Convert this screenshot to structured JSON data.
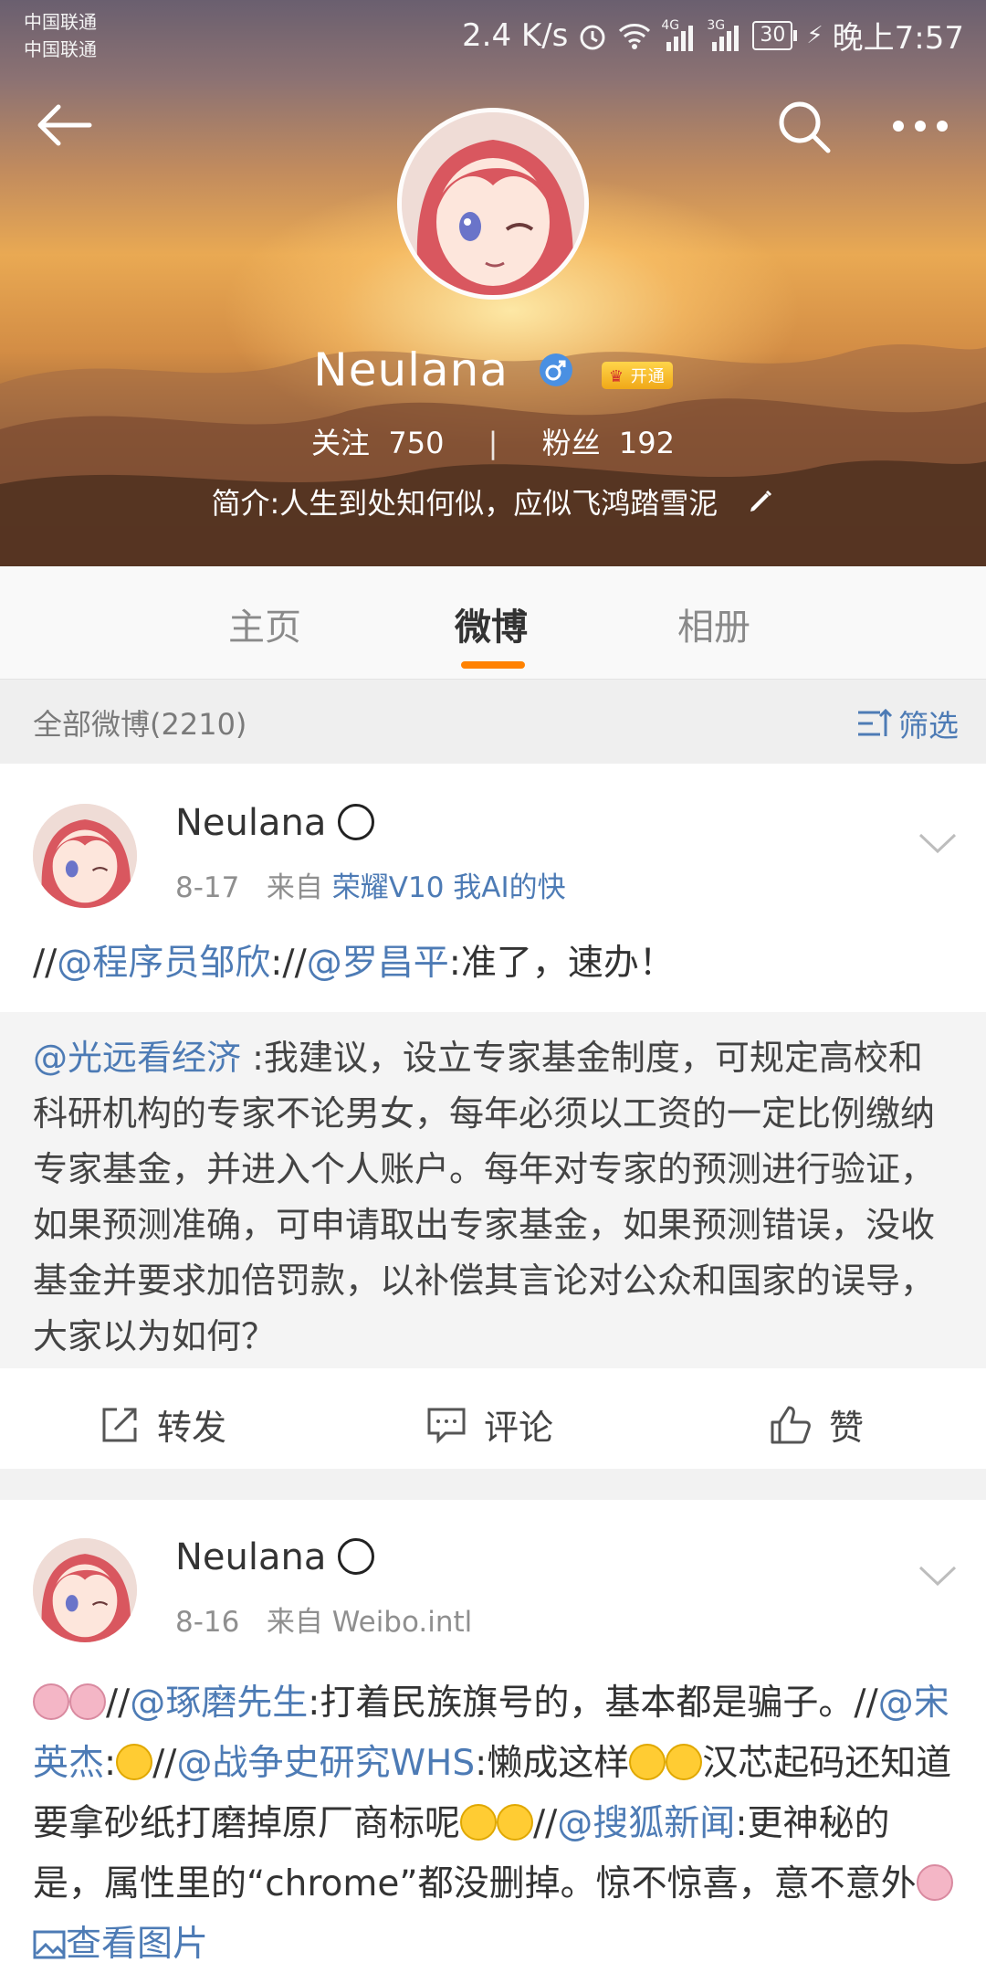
{
  "status_bar": {
    "carrier1": "中国联通",
    "carrier2": "中国联通",
    "speed": "2.4 K/s",
    "net1": "4G",
    "net2": "3G",
    "battery": "30",
    "time": "晚上7:57"
  },
  "profile": {
    "name": "Neulana",
    "vip_badge": "开通",
    "following_label": "关注",
    "following": "750",
    "separator": "|",
    "followers_label": "粉丝",
    "followers": "192",
    "bio": "简介:人生到处知何似，应似飞鸿踏雪泥"
  },
  "icons": {
    "back": "back-arrow-icon",
    "search": "search-icon",
    "more": "more-icon",
    "gender": "male-icon",
    "vip": "crown-icon",
    "edit": "pencil-icon",
    "filter": "filter-icon",
    "repost": "repost-icon",
    "comment": "comment-icon",
    "like": "thumbs-up-icon",
    "chevron": "chevron-down-icon"
  },
  "tabs": [
    {
      "label": "主页"
    },
    {
      "label": "微博"
    },
    {
      "label": "相册"
    }
  ],
  "filter_bar": {
    "all_posts": "全部微博(2210)",
    "filter_label": "筛选"
  },
  "colors": {
    "accent": "#ff8200",
    "link": "#4d7bb5",
    "vip_gold": "#f6b81f",
    "verified_blue": "#4a90e2"
  },
  "posts": [
    {
      "username": "Neulana",
      "date": "8-17",
      "from": "来自",
      "source": "荣耀V10 我AI的快",
      "body": {
        "p1": "//",
        "m1": "@程序员邹欣",
        "p2": "://",
        "m2": "@罗昌平",
        "p3": ":准了，速办！"
      },
      "quote": {
        "mention": "@光远看经济",
        "text": " :我建议，设立专家基金制度，可规定高校和科研机构的专家不论男女，每年必须以工资的一定比例缴纳专家基金，并进入个人账户。每年对专家的预测进行验证，如果预测准确，可申请取出专家基金，如果预测错误，没收基金并要求加倍罚款，以补偿其言论对公众和国家的误导，大家以为如何？"
      },
      "actions": {
        "repost": "转发",
        "comment": "评论",
        "like": "赞"
      }
    },
    {
      "username": "Neulana",
      "date": "8-16",
      "from": "来自",
      "source": "Weibo.intl",
      "body": {
        "p1": "//",
        "m1": "@琢磨先生",
        "p2": ":打着民族旗号的，基本都是骗子。//",
        "m2": "@宋英杰",
        "p3": ":",
        "p4": "//",
        "m3": "@战争史研究WHS",
        "p5": ":懒成这样",
        "p6": "汉芯起码还知道要拿砂纸打磨掉原厂商标呢",
        "p7": "//",
        "m4": "@搜狐新闻",
        "p8": ":更神秘的是，属性里的“chrome”都没删掉。惊不惊喜，意不意外",
        "view_image": "查看图片"
      }
    }
  ]
}
